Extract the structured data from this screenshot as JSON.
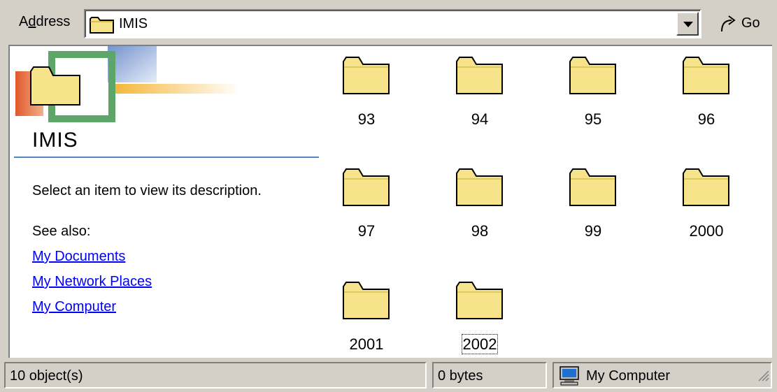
{
  "address_bar": {
    "label": "Address",
    "value": "IMIS",
    "go_label": "Go"
  },
  "left_panel": {
    "banner_title": "IMIS",
    "description": "Select an item to view its description.",
    "see_also_label": "See also:",
    "links": [
      "My Documents",
      "My Network Places",
      "My Computer"
    ]
  },
  "folders": [
    "93",
    "94",
    "95",
    "96",
    "97",
    "98",
    "99",
    "2000",
    "2001",
    "2002"
  ],
  "selected_folder": "2002",
  "status_bar": {
    "objects": "10 object(s)",
    "size": "0 bytes",
    "zone": "My Computer"
  },
  "colors": {
    "window_face": "#d4d0c8",
    "folder_fill": "#f7e48a",
    "link": "#0000ff",
    "rule": "#4f84c8"
  },
  "icons": {
    "address": "folder-icon",
    "go": "go-arrow-icon",
    "zone": "computer-icon"
  }
}
